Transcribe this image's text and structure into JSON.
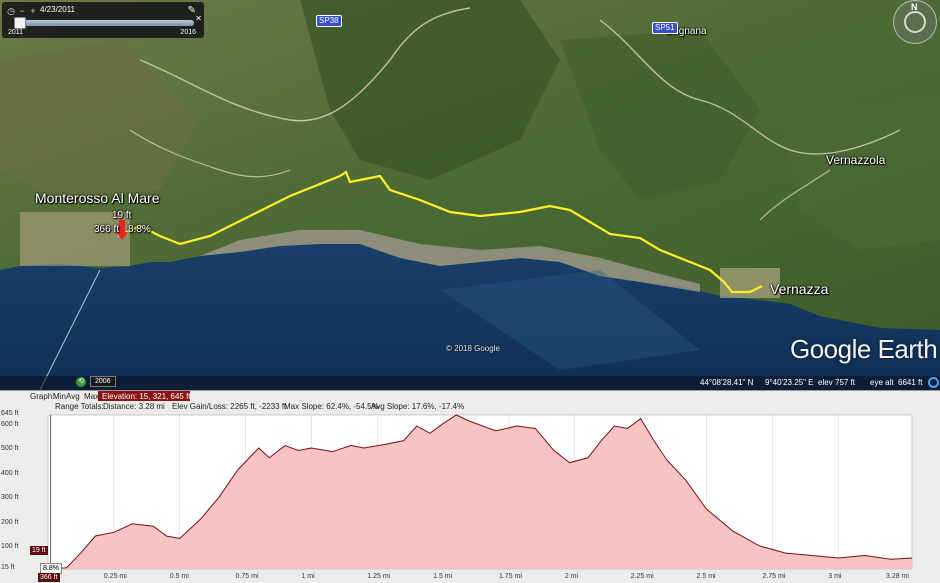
{
  "map": {
    "places": {
      "monterosso": "Monterosso Al Mare",
      "vernazza": "Vernazza",
      "vernazzola": "Vernazzola",
      "drignana": "Drignana"
    },
    "roads": {
      "sp38": "SP38",
      "sp51": "SP51"
    },
    "time_slider": {
      "date": "4/23/2011",
      "start_year": "2011",
      "end_year": "2016"
    },
    "compass_letter": "N",
    "track_markers": {
      "elev": "19 ft",
      "dist": "366 ft",
      "slope": "8.8%"
    },
    "copyright": "© 2018 Google",
    "logo": "Google Earth",
    "imagery_year": "2006",
    "status": {
      "lat": "44°08'28.41\" N",
      "lon": "9°40'23.25\" E",
      "elev_label": "elev",
      "elev": "757 ft",
      "eye_label": "eye alt",
      "eye": "6641 ft"
    }
  },
  "profile": {
    "stats": {
      "graph_label": "Graph:",
      "graph_min": "Min",
      "graph_avg": "Avg",
      "graph_max": "Max",
      "elevation": "Elevation: 15, 321, 645 ft",
      "range_label": "Range Totals:",
      "distance": "Distance: 3.28 mi",
      "gain_loss": "Elev Gain/Loss: 2265 ft, -2233 ft",
      "max_slope": "Max Slope: 62.4%, -54.5%",
      "avg_slope": "Avg Slope: 17.6%, -17.4%"
    },
    "markers": {
      "elev": "19 ft",
      "slope": "8.8%",
      "dist": "366 ft"
    },
    "accent_fill": "#f6b8b8",
    "line_color": "#7a0f0f"
  },
  "chart_data": {
    "type": "area",
    "xlabel": "",
    "ylabel": "",
    "xlim": [
      0,
      3.28
    ],
    "ylim": [
      15,
      645
    ],
    "x_tick_labels": [
      "0.25 mi",
      "0.5 mi",
      "0.75 mi",
      "1 mi",
      "1.25 mi",
      "1.5 mi",
      "1.75 mi",
      "2 mi",
      "2.25 mi",
      "2.5 mi",
      "2.75 mi",
      "3 mi",
      "3.28 mi"
    ],
    "y_tick_labels": [
      "645 ft",
      "600 ft",
      "500 ft",
      "400 ft",
      "300 ft",
      "200 ft",
      "100 ft",
      "15 ft"
    ],
    "x": [
      0,
      0.07,
      0.12,
      0.18,
      0.25,
      0.32,
      0.4,
      0.45,
      0.5,
      0.58,
      0.65,
      0.72,
      0.8,
      0.84,
      0.9,
      0.95,
      1.0,
      1.08,
      1.15,
      1.2,
      1.28,
      1.35,
      1.4,
      1.45,
      1.5,
      1.55,
      1.6,
      1.7,
      1.78,
      1.85,
      1.92,
      1.98,
      2.05,
      2.1,
      2.15,
      2.2,
      2.25,
      2.3,
      2.35,
      2.42,
      2.5,
      2.6,
      2.7,
      2.8,
      2.9,
      3.0,
      3.1,
      3.2,
      3.28
    ],
    "y": [
      15,
      20,
      75,
      150,
      165,
      200,
      190,
      150,
      140,
      220,
      310,
      420,
      510,
      470,
      520,
      500,
      510,
      495,
      520,
      510,
      525,
      540,
      600,
      570,
      610,
      645,
      620,
      580,
      600,
      590,
      500,
      450,
      470,
      540,
      600,
      590,
      630,
      540,
      460,
      380,
      260,
      170,
      110,
      80,
      70,
      60,
      70,
      55,
      60
    ]
  }
}
